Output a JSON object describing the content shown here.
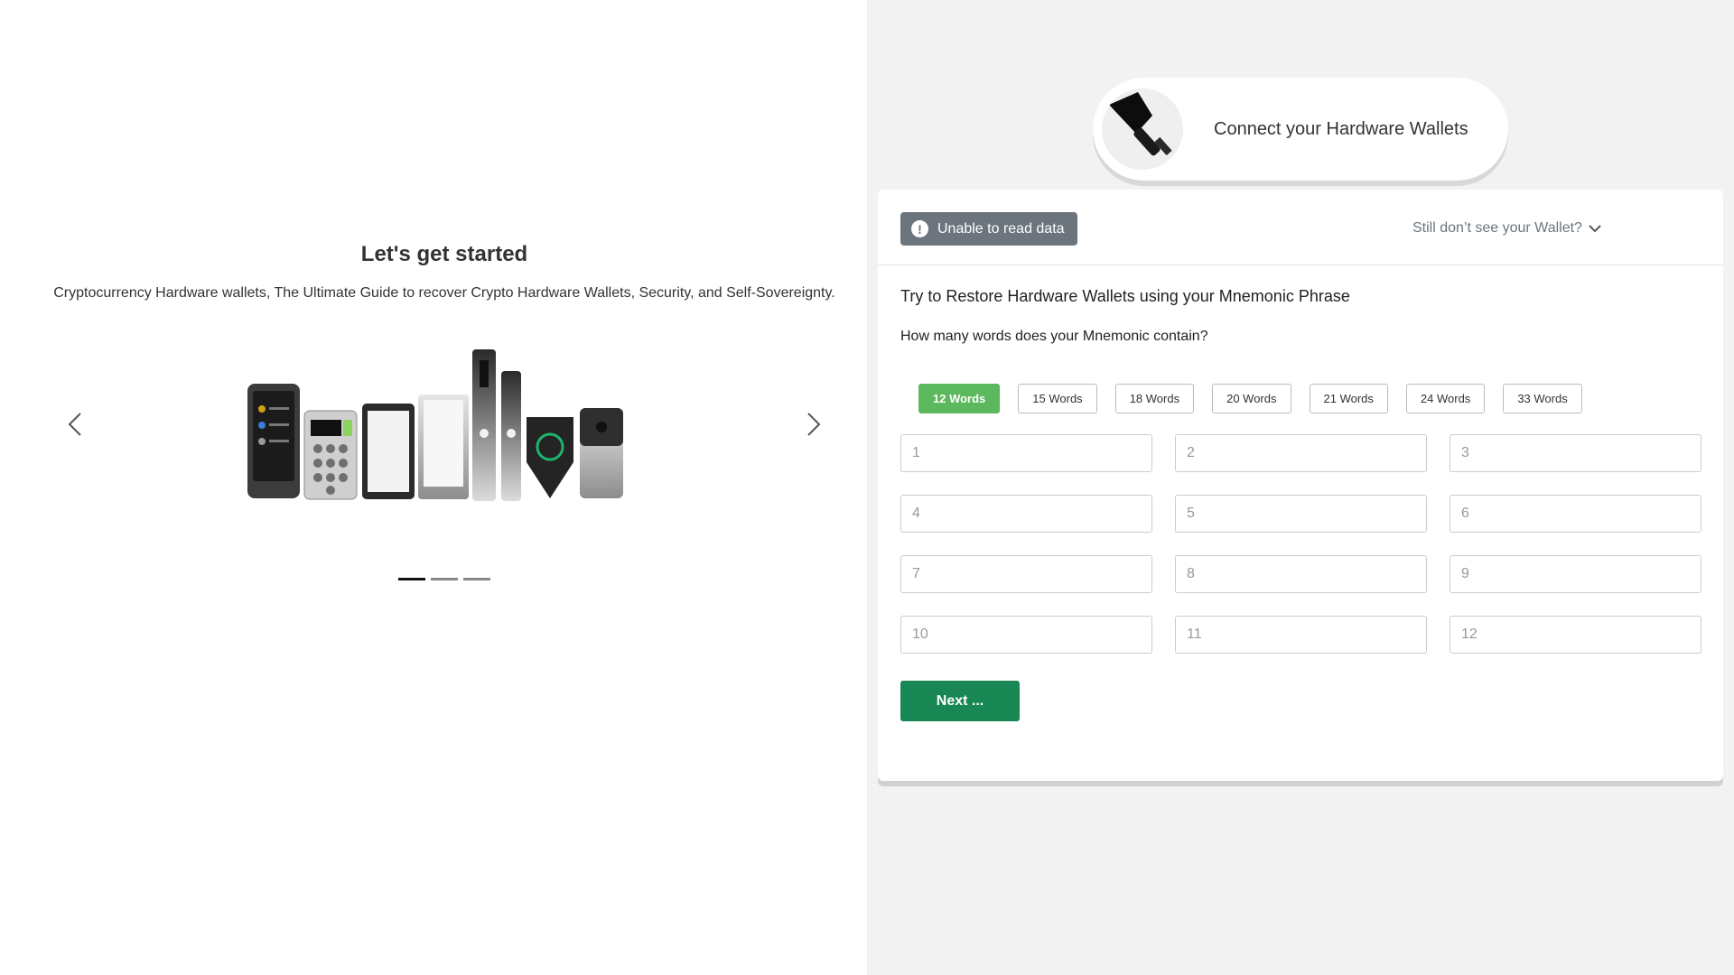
{
  "hero": {
    "title": "Let's get started",
    "subtitle": "Cryptocurrency Hardware wallets, The Ultimate Guide to recover Crypto Hardware Wallets, Security, and Self-Sovereignty."
  },
  "carousel": {
    "prev_icon": "chevron-left-icon",
    "next_icon": "chevron-right-icon",
    "image": "hardware-wallets-illustration",
    "slides": 3,
    "active_index": 0
  },
  "connect": {
    "label": "Connect your Hardware Wallets",
    "icon": "usb-connector-icon"
  },
  "card": {
    "error_text": "Unable to read data",
    "error_icon": "alert-icon",
    "wallet_toggle_text": "Still don’t see your Wallet?",
    "wallet_toggle_icon": "chevron-down-icon",
    "restore_title": "Try to Restore Hardware Wallets using your Mnemonic Phrase",
    "words_question": "How many words does your Mnemonic contain?",
    "word_options": [
      "12 Words",
      "15 Words",
      "18 Words",
      "20 Words",
      "21 Words",
      "24 Words",
      "33 Words"
    ],
    "selected_option": "12 Words",
    "word_placeholders": [
      "1",
      "2",
      "3",
      "4",
      "5",
      "6",
      "7",
      "8",
      "9",
      "10",
      "11",
      "12"
    ],
    "next_label": "Next ..."
  },
  "colors": {
    "accent_green": "#5cb85c",
    "next_green": "#198754",
    "badge_gray": "#6c757d",
    "right_bg": "#f2f2f2"
  }
}
